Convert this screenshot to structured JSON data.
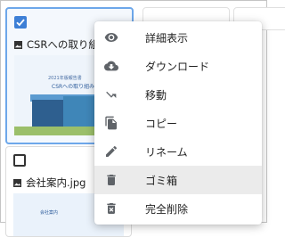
{
  "files": [
    {
      "name": "CSRへの取り組み",
      "selected": true,
      "thumb": {
        "line1": "2021年版報告書",
        "line2": "CSRへの取り組み"
      }
    },
    {
      "name": "会社案内.jpg",
      "selected": false,
      "thumb": {
        "line2": "会社案内"
      }
    }
  ],
  "context_menu": {
    "items": [
      {
        "label": "詳細表示",
        "icon": "eye-icon"
      },
      {
        "label": "ダウンロード",
        "icon": "cloud-download-icon"
      },
      {
        "label": "移動",
        "icon": "move-arrow-icon"
      },
      {
        "label": "コピー",
        "icon": "copy-icon"
      },
      {
        "label": "リネーム",
        "icon": "pencil-icon"
      },
      {
        "label": "ゴミ箱",
        "icon": "trash-icon",
        "highlighted": true
      },
      {
        "label": "完全削除",
        "icon": "delete-forever-icon"
      }
    ]
  },
  "colors": {
    "selection": "#3d7fd6",
    "icon": "#5f6368",
    "highlight": "#ebebeb"
  }
}
